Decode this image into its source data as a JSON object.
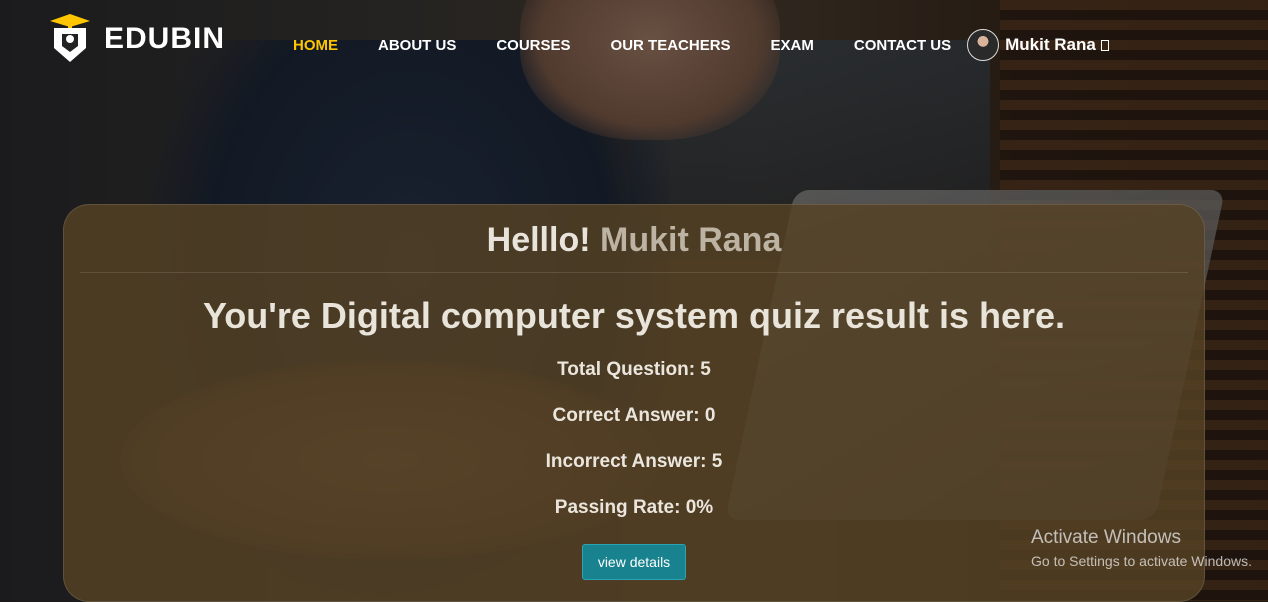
{
  "header": {
    "brand": "EDUBIN",
    "nav": [
      "HOME",
      "ABOUT US",
      "COURSES",
      "OUR TEACHERS",
      "EXAM",
      "CONTACT US"
    ],
    "active_nav": "HOME",
    "user_name": "Mukit Rana",
    "user_caret": "▯"
  },
  "result": {
    "greeting": "Helllo!",
    "greeting_name": "Mukit Rana",
    "title": "You're Digital computer system quiz result is here.",
    "total_question": "Total Question: 5",
    "correct_answer": "Correct Answer: 0",
    "incorrect_answer": "Incorrect Answer: 5",
    "passing_rate": "Passing Rate: 0%",
    "button_label": "view details"
  },
  "watermark": {
    "line1": "Activate Windows",
    "line2": "Go to Settings to activate Windows."
  },
  "colors": {
    "accent": "#ffc600",
    "button": "#18828f"
  }
}
